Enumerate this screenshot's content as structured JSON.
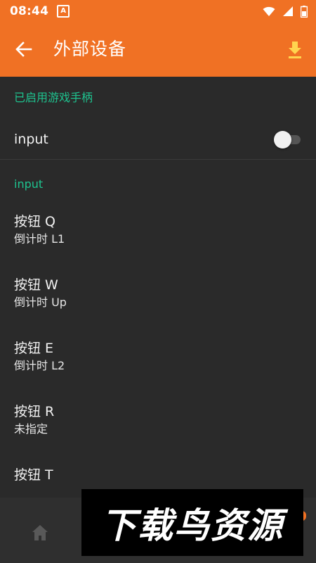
{
  "status_bar": {
    "time": "08:44",
    "notification_letter": "A"
  },
  "app_bar": {
    "title": "外部设备"
  },
  "sections": {
    "enabled_header": "已启用游戏手柄",
    "toggle_label": "input",
    "toggle_on": false,
    "input_header": "input"
  },
  "buttons": [
    {
      "title": "按钮 Q",
      "subtitle": "倒计时 L1"
    },
    {
      "title": "按钮 W",
      "subtitle": "倒计时 Up"
    },
    {
      "title": "按钮 E",
      "subtitle": "倒计时 L2"
    },
    {
      "title": "按钮 R",
      "subtitle": "未指定"
    },
    {
      "title": "按钮 T",
      "subtitle": ""
    }
  ],
  "watermark": {
    "text": "下载鸟资源"
  },
  "colors": {
    "accent": "#f07124",
    "section": "#1ec38f",
    "background": "#2a2a2a"
  }
}
